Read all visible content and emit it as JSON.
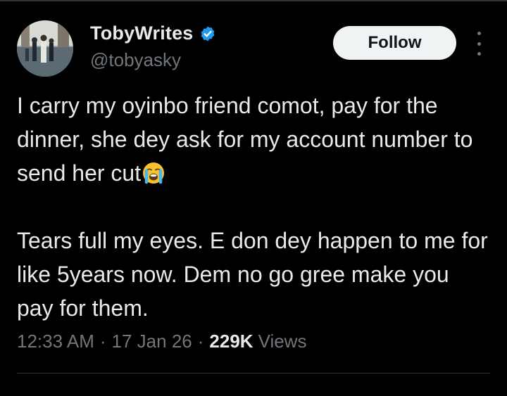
{
  "author": {
    "display_name": "TobyWrites",
    "handle": "@tobyasky",
    "verified": true,
    "verified_color": "#1d9bf0"
  },
  "actions": {
    "follow_label": "Follow",
    "more_icon": "more-vertical-icon"
  },
  "tweet": {
    "paragraph_1": "I carry my oyinbo friend comot, pay for the dinner, she dey ask for my account number to send her cut",
    "emoji_icon": "loudly-crying-face-icon",
    "paragraph_2": "Tears full my eyes. E don dey happen to me for like 5years now. Dem no go gree make you pay for them."
  },
  "meta": {
    "time": "12:33 AM",
    "separator": "·",
    "date": "17 Jan 26",
    "views_count": "229K",
    "views_label": "Views"
  },
  "colors": {
    "background": "#000000",
    "text_primary": "#e7e9ea",
    "text_secondary": "#71767b",
    "follow_bg": "#eff3f4"
  }
}
